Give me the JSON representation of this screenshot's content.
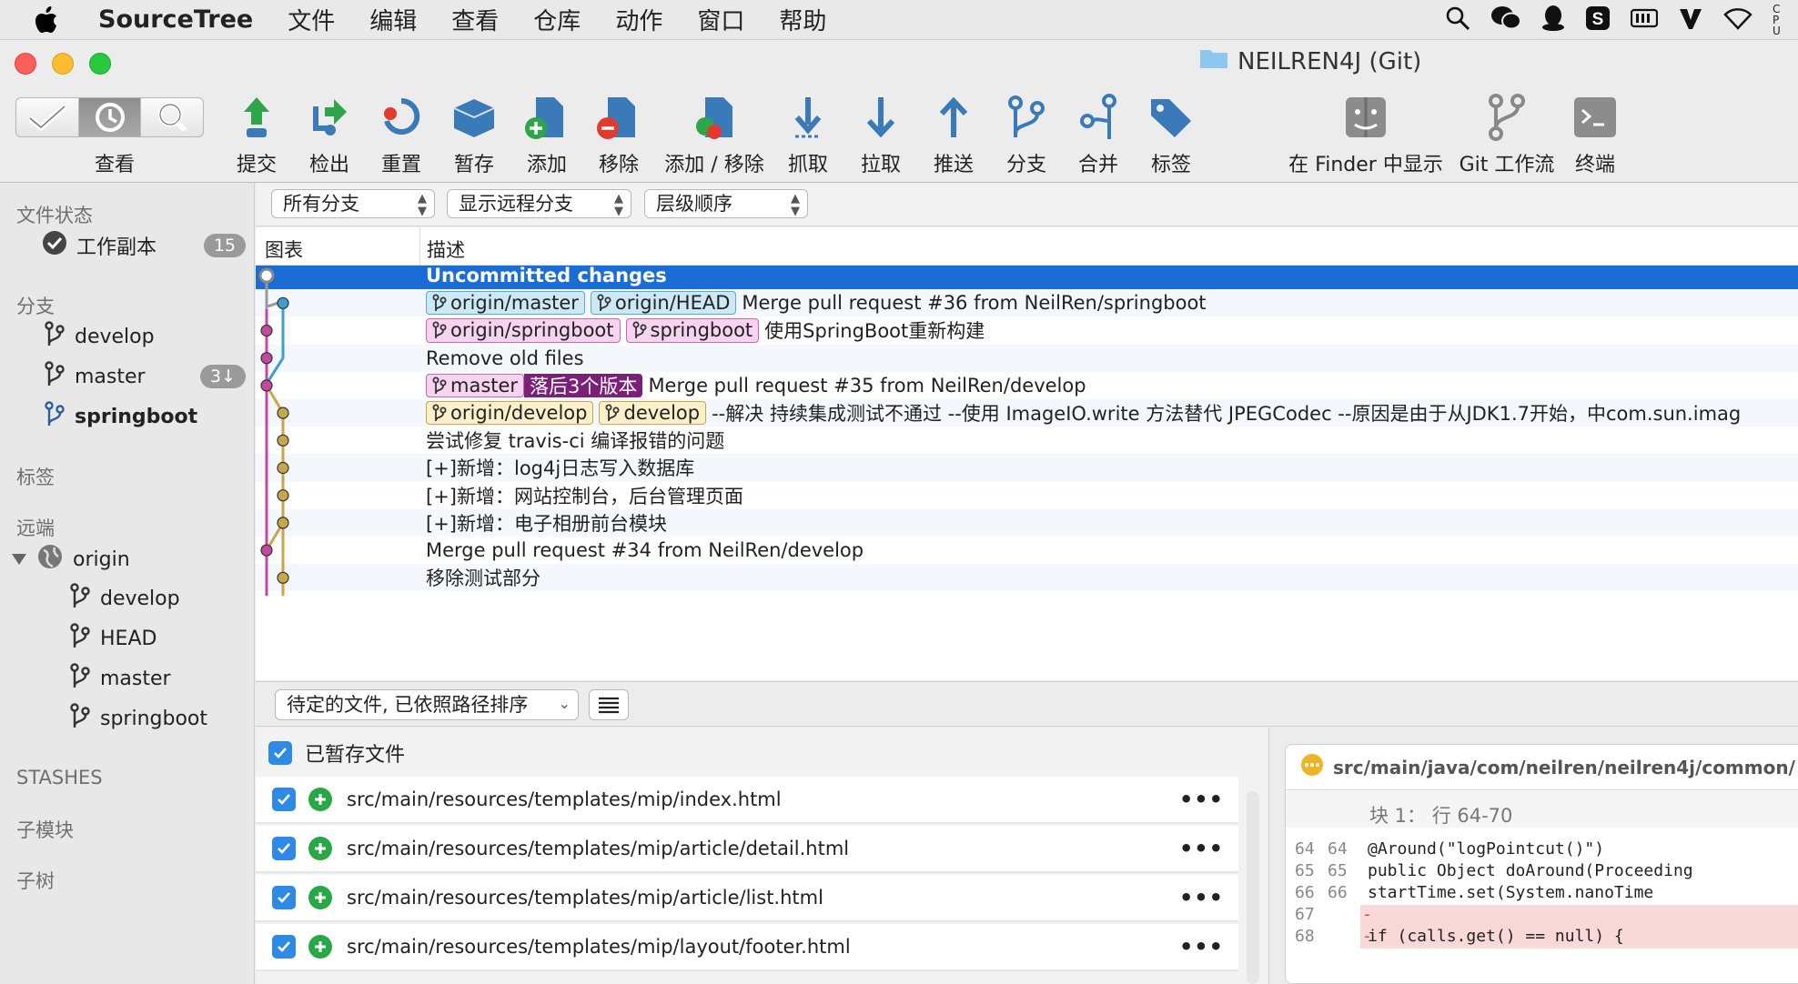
{
  "menubar": {
    "app_name": "SourceTree",
    "items": [
      "文件",
      "编辑",
      "查看",
      "仓库",
      "动作",
      "窗口",
      "帮助"
    ],
    "status_icons": [
      "search-icon",
      "wechat-icon",
      "qq-icon",
      "sogou-icon",
      "memory-icon",
      "vim-icon",
      "wifi-icon",
      "cpu-icon"
    ],
    "cpu_label": "CPU"
  },
  "window": {
    "title": "NEILREN4J (Git)"
  },
  "toolbar": {
    "view_label": "查看",
    "buttons": [
      {
        "label": "提交",
        "icon": "commit-icon"
      },
      {
        "label": "检出",
        "icon": "checkout-icon"
      },
      {
        "label": "重置",
        "icon": "reset-icon"
      },
      {
        "label": "暂存",
        "icon": "stash-icon"
      },
      {
        "label": "添加",
        "icon": "add-icon"
      },
      {
        "label": "移除",
        "icon": "remove-icon"
      },
      {
        "label": "添加 / 移除",
        "icon": "add-remove-icon"
      },
      {
        "label": "抓取",
        "icon": "fetch-icon"
      },
      {
        "label": "拉取",
        "icon": "pull-icon"
      },
      {
        "label": "推送",
        "icon": "push-icon"
      },
      {
        "label": "分支",
        "icon": "branch-icon"
      },
      {
        "label": "合并",
        "icon": "merge-icon"
      },
      {
        "label": "标签",
        "icon": "tag-icon"
      },
      {
        "label": "在 Finder 中显示",
        "icon": "finder-icon"
      },
      {
        "label": "Git 工作流",
        "icon": "git-flow-icon"
      },
      {
        "label": "终端",
        "icon": "terminal-icon"
      }
    ]
  },
  "sidebar": {
    "file_status_header": "文件状态",
    "working_copy": {
      "label": "工作副本",
      "count": "15"
    },
    "branches_header": "分支",
    "branches": [
      {
        "label": "develop",
        "badge": "",
        "current": false
      },
      {
        "label": "master",
        "badge": "3↓",
        "current": false
      },
      {
        "label": "springboot",
        "badge": "",
        "current": true
      }
    ],
    "tags_header": "标签",
    "remotes_header": "远端",
    "remote": {
      "label": "origin",
      "branches": [
        "develop",
        "HEAD",
        "master",
        "springboot"
      ]
    },
    "stashes_header": "STASHES",
    "submodules_header": "子模块",
    "subtrees_header": "子树"
  },
  "filters": {
    "branches": "所有分支",
    "remote": "显示远程分支",
    "order": "层级顺序"
  },
  "columns": {
    "graph": "图表",
    "description": "描述"
  },
  "commits": [
    {
      "tags": [],
      "message": "Uncommitted changes",
      "selected": true
    },
    {
      "tags": [
        {
          "label": "origin/master",
          "color": "blue"
        },
        {
          "label": "origin/HEAD",
          "color": "blue"
        }
      ],
      "message": "Merge pull request #36 from NeilRen/springboot"
    },
    {
      "tags": [
        {
          "label": "origin/springboot",
          "color": "pink"
        },
        {
          "label": "springboot",
          "color": "pink"
        }
      ],
      "message": "使用SpringBoot重新构建"
    },
    {
      "tags": [],
      "message": "Remove old files"
    },
    {
      "tags": [
        {
          "label": "master",
          "color": "pink",
          "behind": "落后3个版本"
        }
      ],
      "message": "Merge pull request #35 from NeilRen/develop"
    },
    {
      "tags": [
        {
          "label": "origin/develop",
          "color": "yellow"
        },
        {
          "label": "develop",
          "color": "yellow"
        }
      ],
      "message": "--解决 持续集成测试不通过 --使用 ImageIO.write 方法替代 JPEGCodec --原因是由于从JDK1.7开始，中com.sun.imag"
    },
    {
      "tags": [],
      "message": "尝试修复 travis-ci 编译报错的问题"
    },
    {
      "tags": [],
      "message": "[+]新增：log4j日志写入数据库"
    },
    {
      "tags": [],
      "message": "[+]新增：网站控制台，后台管理页面"
    },
    {
      "tags": [],
      "message": "[+]新增：电子相册前台模块"
    },
    {
      "tags": [],
      "message": "Merge pull request #34 from NeilRen/develop"
    },
    {
      "tags": [],
      "message": "移除测试部分"
    }
  ],
  "files_panel": {
    "sort_select": "待定的文件, 已依照路径排序",
    "staged_header": "已暂存文件",
    "files": [
      "src/main/resources/templates/mip/index.html",
      "src/main/resources/templates/mip/article/detail.html",
      "src/main/resources/templates/mip/article/list.html",
      "src/main/resources/templates/mip/layout/footer.html"
    ],
    "more_label": "•••"
  },
  "diff": {
    "file_path": "src/main/java/com/neilren/neilren4j/common/",
    "hunk_label": "块 1：  行 64-70",
    "lines": [
      {
        "old": "64",
        "new": "64",
        "mark": "",
        "code": "    @Around(\"logPointcut()\")",
        "type": "ctx"
      },
      {
        "old": "65",
        "new": "65",
        "mark": "",
        "code": "    public Object doAround(Proceeding",
        "type": "ctx"
      },
      {
        "old": "66",
        "new": "66",
        "mark": "",
        "code": "        startTime.set(System.nanoTime",
        "type": "ctx"
      },
      {
        "old": "67",
        "new": "",
        "mark": "-",
        "code": "",
        "type": "del"
      },
      {
        "old": "68",
        "new": "",
        "mark": "-",
        "code": "        if (calls.get() == null) {",
        "type": "del"
      }
    ]
  },
  "colors": {
    "selection": "#1a6dd5",
    "lane_pink": "#c3489f",
    "lane_blue": "#3c9fd1",
    "lane_yellow": "#c7a64c",
    "lane_gray": "#999999"
  }
}
